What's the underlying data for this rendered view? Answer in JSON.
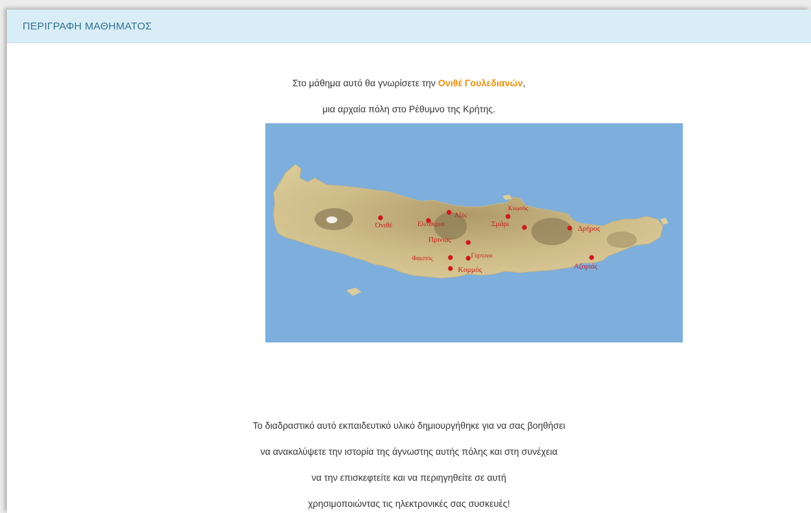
{
  "header": {
    "title": "ΠΕΡΙΓΡΑΦΗ ΜΑΘΗΜΑΤΟΣ"
  },
  "intro": {
    "line1_before": "Στο μάθημα αυτό θα γνωρίσετε την ",
    "line1_highlight": "Ονιθέ Γουλεδιανών",
    "line1_after": ",",
    "line2": "μια αρχαία πόλη στο Ρέθυμνο της Κρήτης."
  },
  "map": {
    "sea_color": "#7eaedc",
    "marker_color": "#cc1a1a",
    "places": [
      {
        "key": "onithe",
        "label": "Ονιθέ"
      },
      {
        "key": "axos",
        "label": "Αξός"
      },
      {
        "key": "eleutherna",
        "label": "Ελεύθερνα"
      },
      {
        "key": "prinias",
        "label": "Πρινιάς"
      },
      {
        "key": "knossos",
        "label": "Κνωσός"
      },
      {
        "key": "smari",
        "label": "Σμάρι"
      },
      {
        "key": "driros",
        "label": "Δρήρος"
      },
      {
        "key": "phaistos",
        "label": "Φαιστός"
      },
      {
        "key": "gortyna",
        "label": "Γόρτυνα"
      },
      {
        "key": "kommos",
        "label": "Κομμός"
      },
      {
        "key": "azorias",
        "label": "Αζοριάς"
      }
    ]
  },
  "description": {
    "lines": [
      "Το διαδραστικό αυτό εκπαιδευτικό υλικό δημιουργήθηκε για να σας βοηθήσει",
      "να ανακαλύψετε την ιστορία της άγνωστης αυτής πόλης και στη συνέχεια",
      "να την επισκεφτείτε  και να περιηγηθείτε σε αυτή",
      "χρησιμοποιώντας τις ηλεκτρονικές σας συσκευές!"
    ]
  }
}
